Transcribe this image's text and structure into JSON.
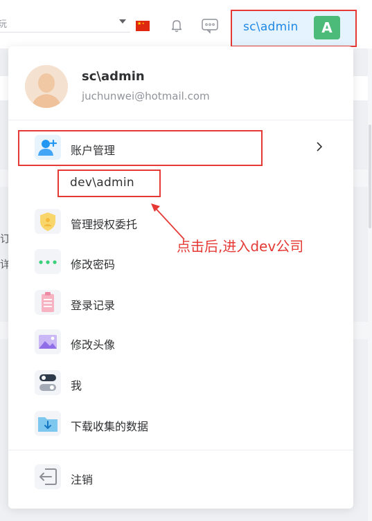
{
  "topbar": {
    "lang_partial": "玩",
    "current_user": "sc\\admin",
    "avatar_letter": "A"
  },
  "background": {
    "chars": [
      "订",
      "详"
    ]
  },
  "profile": {
    "name": "sc\\admin",
    "email": "juchunwei@hotmail.com"
  },
  "menu": {
    "account_management": "账户管理",
    "sub_accounts": [
      "dev\\admin"
    ],
    "delegation": "管理授权委托",
    "change_password": "修改密码",
    "login_records": "登录记录",
    "change_avatar": "修改头像",
    "me": "我",
    "download_data": "下载收集的数据",
    "logout": "注销"
  },
  "annotation": {
    "text": "点击后,进入dev公司"
  },
  "colors": {
    "accent": "#1e88e5",
    "avatar_bg": "#4cbb7a",
    "annotation": "#e53935"
  },
  "icons": [
    "chevron-down-icon",
    "china-flag-icon",
    "bell-icon",
    "chat-icon",
    "add-user-icon",
    "shield-icon",
    "dots-icon",
    "clipboard-icon",
    "image-icon",
    "toggle-icon",
    "download-folder-icon",
    "logout-icon",
    "chevron-right-icon"
  ]
}
